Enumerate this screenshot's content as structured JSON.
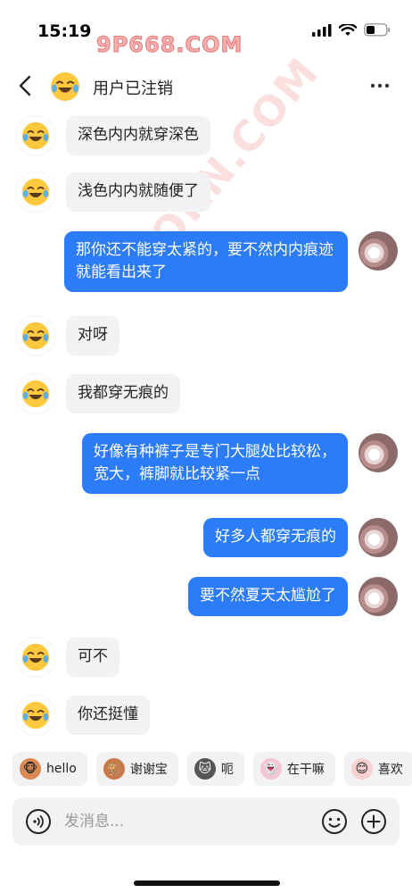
{
  "status_bar": {
    "time": "15:19"
  },
  "watermark": {
    "top_text": "9P668.COM",
    "diagonal_text": "...ORN.COM"
  },
  "header": {
    "title": "用户已注销"
  },
  "messages": [
    {
      "side": "left",
      "text": "深色内内就穿深色"
    },
    {
      "side": "left",
      "text": "浅色内内就随便了"
    },
    {
      "side": "right",
      "text": "那你还不能穿太紧的，要不然内内痕迹就能看出来了"
    },
    {
      "side": "left",
      "text": "对呀"
    },
    {
      "side": "left",
      "text": "我都穿无痕的"
    },
    {
      "side": "right",
      "text": "好像有种裤子是专门大腿处比较松，宽大，裤脚就比较紧一点"
    },
    {
      "side": "right",
      "text": "好多人都穿无痕的"
    },
    {
      "side": "right",
      "text": "要不然夏天太尴尬了"
    },
    {
      "side": "left",
      "text": "可不"
    },
    {
      "side": "left",
      "text": "你还挺懂"
    }
  ],
  "quick_replies": [
    {
      "label": "hello",
      "icon": "monkey-icon",
      "color": "#d98a54"
    },
    {
      "label": "谢谢宝",
      "icon": "monkey-flower-icon",
      "color": "#c9794a"
    },
    {
      "label": "呃",
      "icon": "cat-icon",
      "color": "#555555"
    },
    {
      "label": "在干嘛",
      "icon": "ghost-icon",
      "color": "#e07d9a"
    },
    {
      "label": "喜欢",
      "icon": "mascot-icon",
      "color": "#e89a9a"
    }
  ],
  "composer": {
    "placeholder": "发消息..."
  },
  "colors": {
    "outgoing_bubble": "#2b7cf6",
    "incoming_bubble": "#f2f2f4",
    "accent": "#2b7cf6"
  }
}
